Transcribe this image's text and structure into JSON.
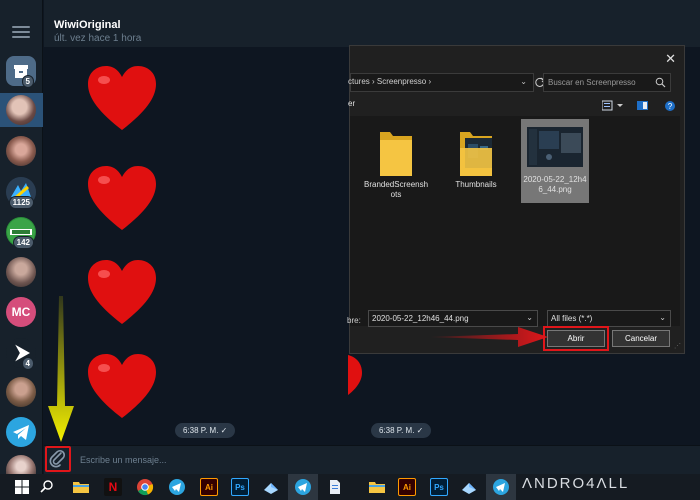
{
  "chat": {
    "name": "WiwiOriginal",
    "status": "últ. vez hace 1 hora",
    "input_placeholder": "Escribe un mensaje...",
    "times": [
      "6:38 P. M.",
      "6:38 P. M."
    ],
    "checkmark": "✓"
  },
  "sidebar": {
    "badges": [
      "5",
      "1125",
      "142",
      "4"
    ],
    "mc_initials": "MC"
  },
  "dialog": {
    "close": "✕",
    "address": "ctures  ›  Screenpresso  ›",
    "search_placeholder": "Buscar en Screenpresso",
    "organize_label": "er",
    "files": [
      {
        "name": "BrandedScreenshots",
        "display": "BrandedScreensh\nots"
      },
      {
        "name": "Thumbnails",
        "display": "Thumbnails"
      },
      {
        "name": "2020-05-22_12h46_44.png",
        "display": "2020-05-22_12h4\n6_44.png"
      }
    ],
    "filename_label": "bre:",
    "filename_value": "2020-05-22_12h46_44.png",
    "filetype_value": "All files (*.*)",
    "open_label": "Abrir",
    "cancel_label": "Cancelar"
  },
  "taskbar": {
    "ai_label": "Ai",
    "ps_label": "Ps",
    "watermark": "ΛNDRO4ΛLL"
  },
  "colors": {
    "accent_red": "#e0161a",
    "highlight_yellow": "#f4f000",
    "telegram_blue": "#2ca5e0"
  }
}
